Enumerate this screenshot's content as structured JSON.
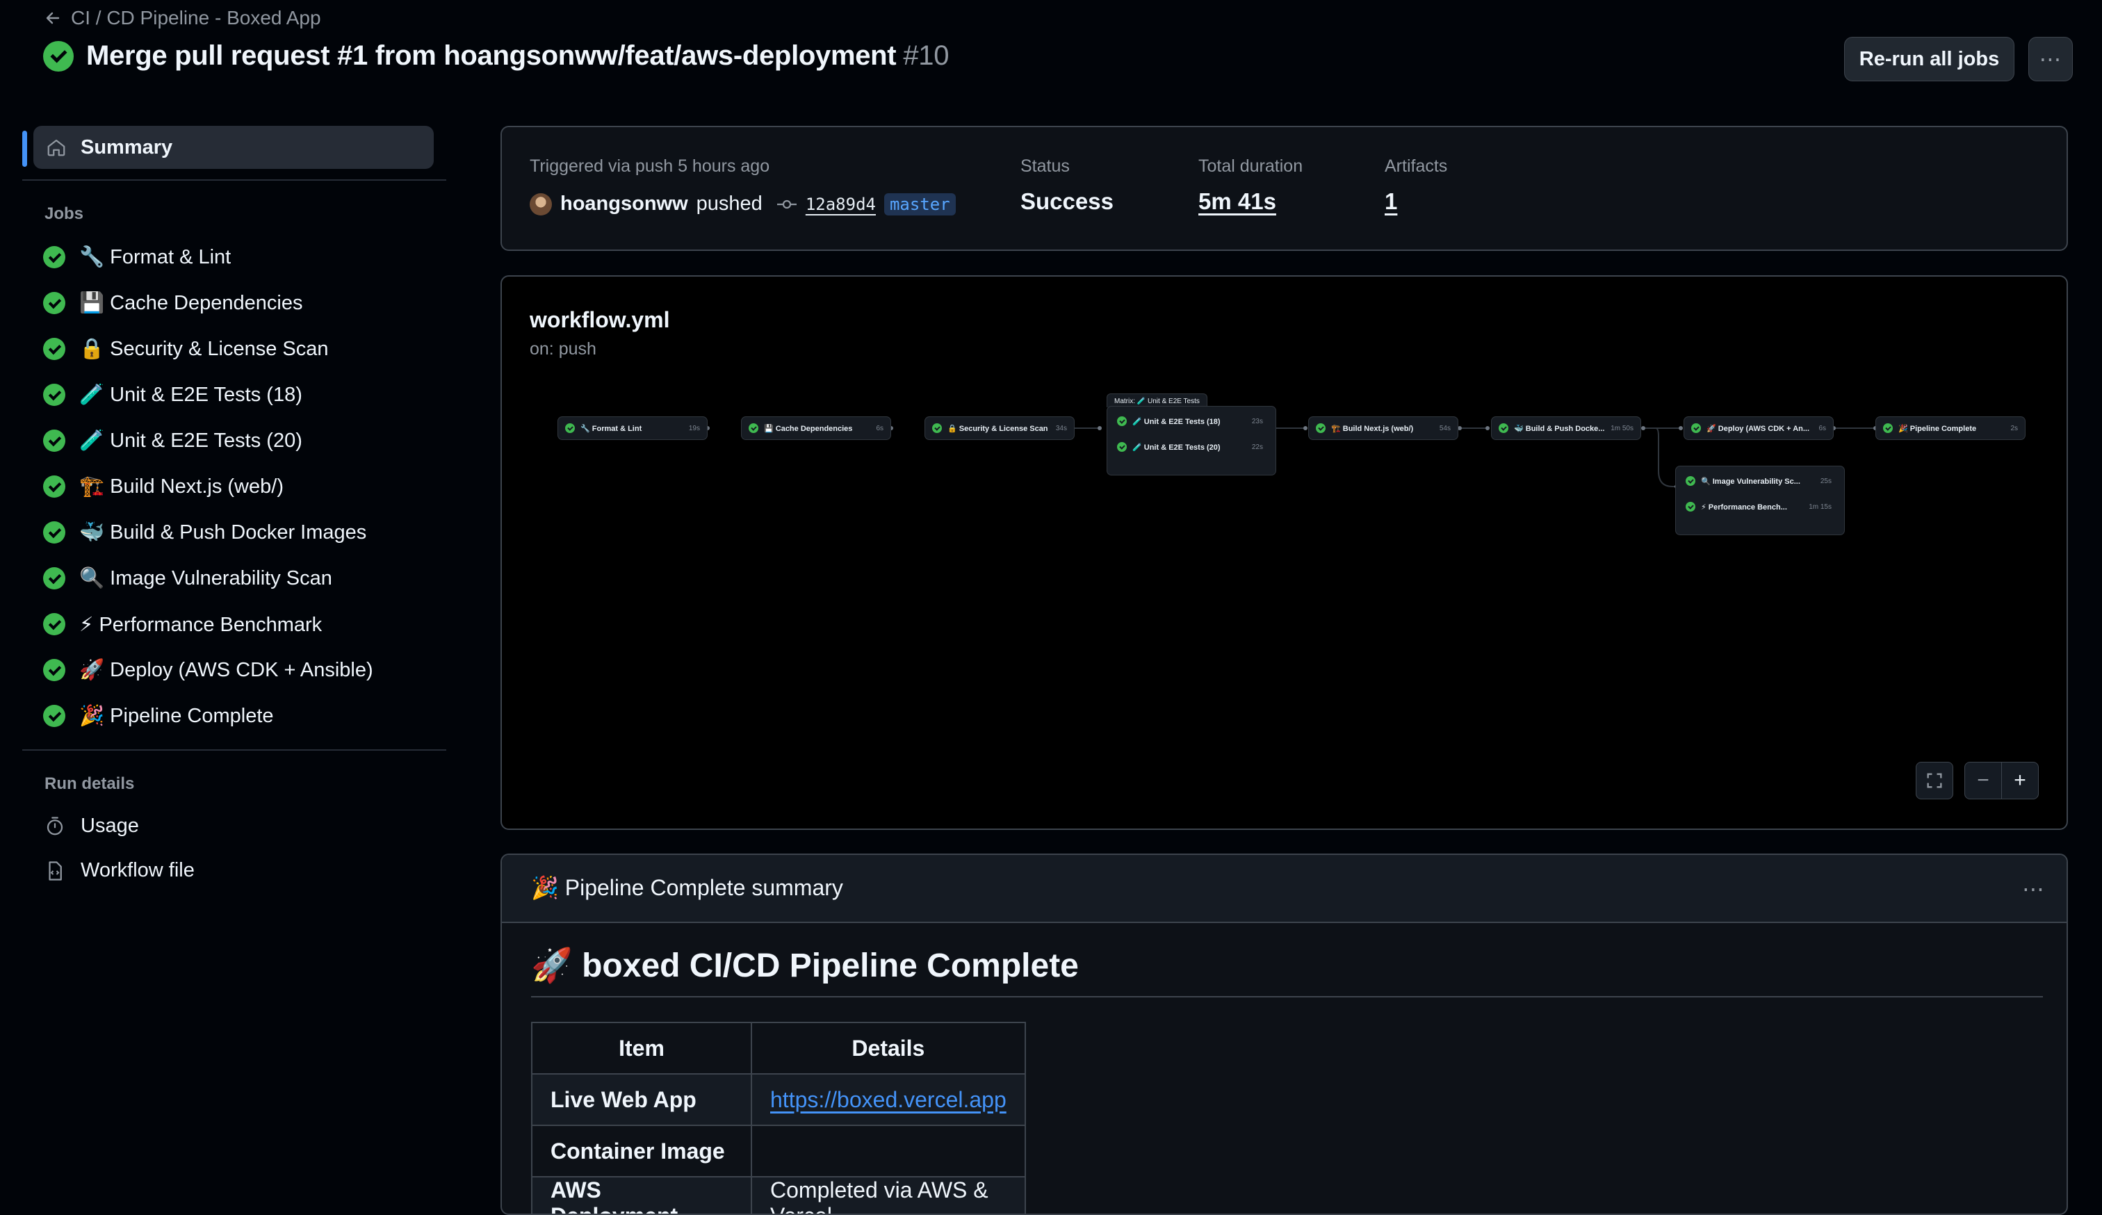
{
  "header": {
    "back_label": "CI / CD Pipeline - Boxed App",
    "title": "Merge pull request #1 from hoangsonww/feat/aws-deployment",
    "run_number": "#10",
    "rerun_label": "Re-run all jobs",
    "more_label": "⋯"
  },
  "sidebar": {
    "summary_label": "Summary",
    "jobs_heading": "Jobs",
    "jobs": [
      {
        "icon": "🔧",
        "label": "Format & Lint"
      },
      {
        "icon": "💾",
        "label": "Cache Dependencies"
      },
      {
        "icon": "🔒",
        "label": "Security & License Scan"
      },
      {
        "icon": "🧪",
        "label": "Unit & E2E Tests (18)"
      },
      {
        "icon": "🧪",
        "label": "Unit & E2E Tests (20)"
      },
      {
        "icon": "🏗️",
        "label": "Build Next.js (web/)"
      },
      {
        "icon": "🐳",
        "label": "Build & Push Docker Images"
      },
      {
        "icon": "🔍",
        "label": "Image Vulnerability Scan"
      },
      {
        "icon": "⚡",
        "label": "Performance Benchmark"
      },
      {
        "icon": "🚀",
        "label": "Deploy (AWS CDK + Ansible)"
      },
      {
        "icon": "🎉",
        "label": "Pipeline Complete"
      }
    ],
    "run_details_heading": "Run details",
    "usage_label": "Usage",
    "workflow_file_label": "Workflow file"
  },
  "summary": {
    "triggered_text": "Triggered via push 5 hours ago",
    "actor": "hoangsonww",
    "action": "pushed",
    "commit": "12a89d4",
    "branch": "master",
    "status_label": "Status",
    "status_value": "Success",
    "duration_label": "Total duration",
    "duration_value": "5m 41s",
    "artifacts_label": "Artifacts",
    "artifacts_value": "1"
  },
  "workflow": {
    "file": "workflow.yml",
    "trigger": "on: push",
    "nodes": {
      "format": {
        "label": "🔧 Format & Lint",
        "duration": "19s"
      },
      "cache": {
        "label": "💾 Cache Dependencies",
        "duration": "6s"
      },
      "security": {
        "label": "🔒 Security & License Scan",
        "duration": "34s"
      },
      "matrix_title": "Matrix: 🧪 Unit & E2E Tests",
      "tests18": {
        "label": "🧪 Unit & E2E Tests (18)",
        "duration": "23s"
      },
      "tests20": {
        "label": "🧪 Unit & E2E Tests (20)",
        "duration": "22s"
      },
      "build_web": {
        "label": "🏗️ Build Next.js (web/)",
        "duration": "54s"
      },
      "docker": {
        "label": "🐳 Build & Push Docke...",
        "duration": "1m 50s"
      },
      "deploy": {
        "label": "🚀 Deploy (AWS CDK + An...",
        "duration": "6s"
      },
      "complete": {
        "label": "🎉 Pipeline Complete",
        "duration": "2s"
      },
      "vuln": {
        "label": "🔍 Image Vulnerability Sc...",
        "duration": "25s"
      },
      "perf": {
        "label": "⚡ Performance Bench...",
        "duration": "1m 15s"
      }
    }
  },
  "job_summary": {
    "title": "🎉 Pipeline Complete summary",
    "heading": "🚀 boxed CI/CD Pipeline Complete",
    "table": {
      "headers": [
        "Item",
        "Details"
      ],
      "rows": [
        {
          "item": "Live Web App",
          "details": "https://boxed.vercel.app",
          "is_link": true
        },
        {
          "item": "Container Image",
          "details": ""
        },
        {
          "item": "AWS Deployment",
          "details": "Completed via AWS & Vercel"
        }
      ]
    }
  },
  "colors": {
    "success": "#3fb950",
    "accent": "#4493f8",
    "background": "#010409",
    "panel": "#0d1117",
    "border": "#3d444d"
  }
}
